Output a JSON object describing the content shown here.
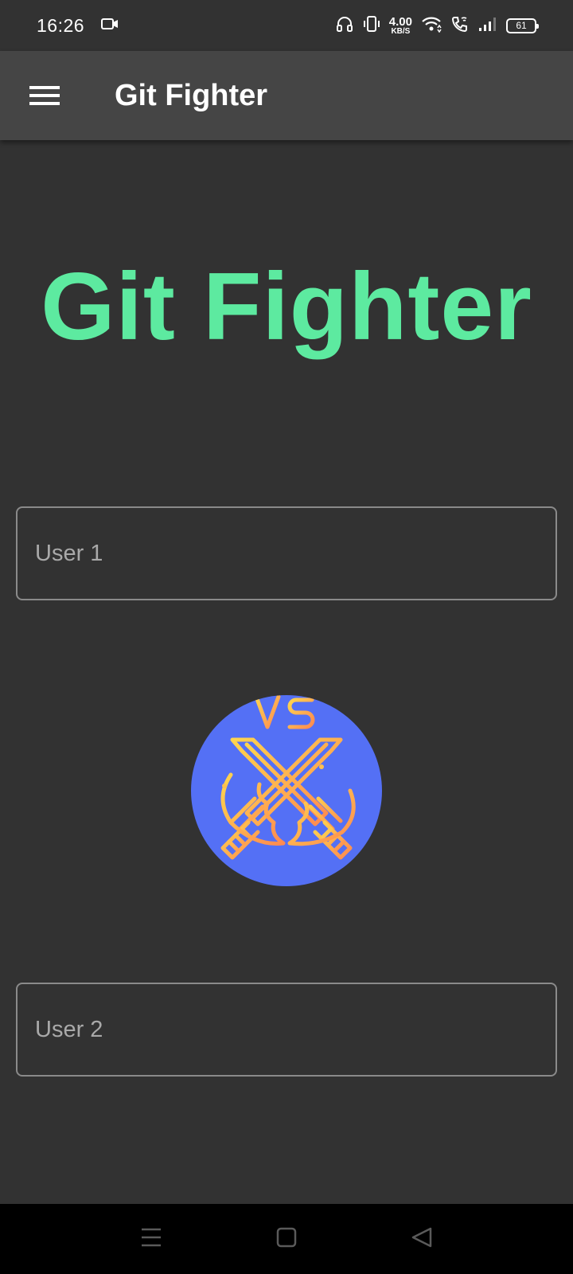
{
  "status_bar": {
    "time": "16:26",
    "net_speed_value": "4.00",
    "net_speed_unit": "KB/S",
    "battery_level": "61",
    "icons": [
      "video-camera-icon",
      "headset-icon",
      "vibrate-icon",
      "wifi-icon",
      "wifi-calling-icon",
      "signal-icon",
      "battery-icon"
    ]
  },
  "app_bar": {
    "title": "Git Fighter",
    "menu_icon": "hamburger-menu-icon"
  },
  "main": {
    "hero_title": "Git Fighter",
    "user1": {
      "placeholder": "User 1",
      "value": ""
    },
    "user2": {
      "placeholder": "User 2",
      "value": ""
    },
    "logo": {
      "text": "VS",
      "icon": "crossed-swords-icon"
    }
  },
  "colors": {
    "background": "#323232",
    "app_bar": "#454545",
    "hero_accent": "#5deaa0",
    "logo_circle": "#5470f5",
    "logo_gradient_start": "#ffd54f",
    "logo_gradient_end": "#ff8a50"
  },
  "nav_bar": {
    "items": [
      "recent-apps-icon",
      "home-icon",
      "back-icon"
    ]
  }
}
